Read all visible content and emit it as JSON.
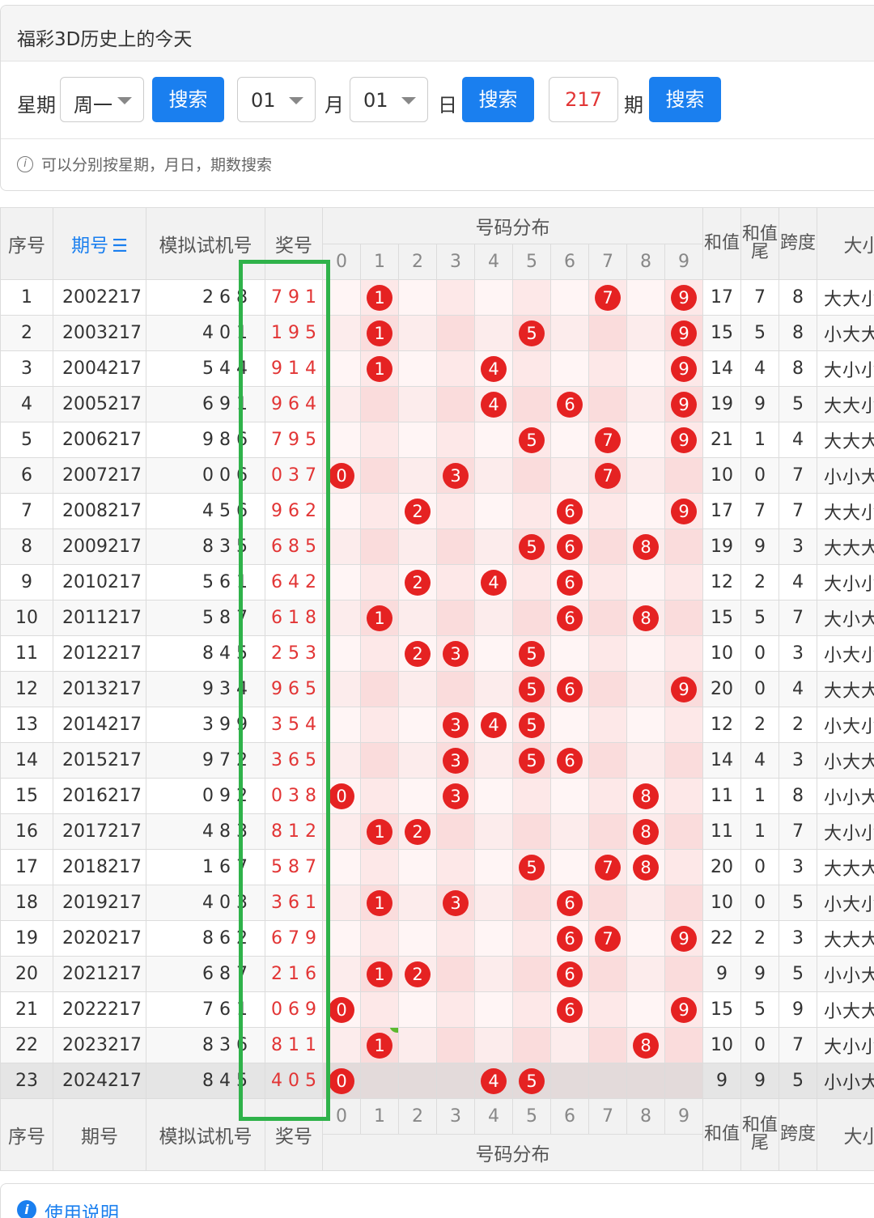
{
  "page": {
    "title": "福彩3D历史上的今天"
  },
  "search": {
    "weekday_label": "星期",
    "weekday_value": "周一",
    "search_label": "搜索",
    "month_value": "01",
    "month_label": "月",
    "day_value": "01",
    "day_label": "日",
    "issue_value": "217",
    "issue_label": "期"
  },
  "tip": "可以分别按星期，月日，期数搜索",
  "table": {
    "head": {
      "seq": "序号",
      "issue": "期号",
      "sim": "模拟试机号",
      "win": "奖号",
      "dist": "号码分布",
      "sum": "和值",
      "sumtail": "和值尾",
      "span": "跨度",
      "dx": "大小"
    },
    "digits": [
      "0",
      "1",
      "2",
      "3",
      "4",
      "5",
      "6",
      "7",
      "8",
      "9"
    ],
    "rows": [
      {
        "seq": "1",
        "issue": "2002217",
        "sim": "268",
        "win": "791",
        "sum": "17",
        "tail": "7",
        "span": "8",
        "dx": "大大小"
      },
      {
        "seq": "2",
        "issue": "2003217",
        "sim": "401",
        "win": "195",
        "sum": "15",
        "tail": "5",
        "span": "8",
        "dx": "小大大"
      },
      {
        "seq": "3",
        "issue": "2004217",
        "sim": "544",
        "win": "914",
        "sum": "14",
        "tail": "4",
        "span": "8",
        "dx": "大小小"
      },
      {
        "seq": "4",
        "issue": "2005217",
        "sim": "691",
        "win": "964",
        "sum": "19",
        "tail": "9",
        "span": "5",
        "dx": "大大小"
      },
      {
        "seq": "5",
        "issue": "2006217",
        "sim": "986",
        "win": "795",
        "sum": "21",
        "tail": "1",
        "span": "4",
        "dx": "大大大"
      },
      {
        "seq": "6",
        "issue": "2007217",
        "sim": "006",
        "win": "037",
        "sum": "10",
        "tail": "0",
        "span": "7",
        "dx": "小小大"
      },
      {
        "seq": "7",
        "issue": "2008217",
        "sim": "456",
        "win": "962",
        "sum": "17",
        "tail": "7",
        "span": "7",
        "dx": "大大小"
      },
      {
        "seq": "8",
        "issue": "2009217",
        "sim": "835",
        "win": "685",
        "sum": "19",
        "tail": "9",
        "span": "3",
        "dx": "大大大"
      },
      {
        "seq": "9",
        "issue": "2010217",
        "sim": "561",
        "win": "642",
        "sum": "12",
        "tail": "2",
        "span": "4",
        "dx": "大小小"
      },
      {
        "seq": "10",
        "issue": "2011217",
        "sim": "587",
        "win": "618",
        "sum": "15",
        "tail": "5",
        "span": "7",
        "dx": "大小大"
      },
      {
        "seq": "11",
        "issue": "2012217",
        "sim": "845",
        "win": "253",
        "sum": "10",
        "tail": "0",
        "span": "3",
        "dx": "小大小"
      },
      {
        "seq": "12",
        "issue": "2013217",
        "sim": "934",
        "win": "965",
        "sum": "20",
        "tail": "0",
        "span": "4",
        "dx": "大大大"
      },
      {
        "seq": "13",
        "issue": "2014217",
        "sim": "399",
        "win": "354",
        "sum": "12",
        "tail": "2",
        "span": "2",
        "dx": "小大小"
      },
      {
        "seq": "14",
        "issue": "2015217",
        "sim": "972",
        "win": "365",
        "sum": "14",
        "tail": "4",
        "span": "3",
        "dx": "小大大"
      },
      {
        "seq": "15",
        "issue": "2016217",
        "sim": "092",
        "win": "038",
        "sum": "11",
        "tail": "1",
        "span": "8",
        "dx": "小小大"
      },
      {
        "seq": "16",
        "issue": "2017217",
        "sim": "483",
        "win": "812",
        "sum": "11",
        "tail": "1",
        "span": "7",
        "dx": "大小小"
      },
      {
        "seq": "17",
        "issue": "2018217",
        "sim": "167",
        "win": "587",
        "sum": "20",
        "tail": "0",
        "span": "3",
        "dx": "大大大"
      },
      {
        "seq": "18",
        "issue": "2019217",
        "sim": "403",
        "win": "361",
        "sum": "10",
        "tail": "0",
        "span": "5",
        "dx": "小大小"
      },
      {
        "seq": "19",
        "issue": "2020217",
        "sim": "862",
        "win": "679",
        "sum": "22",
        "tail": "2",
        "span": "3",
        "dx": "大大大"
      },
      {
        "seq": "20",
        "issue": "2021217",
        "sim": "687",
        "win": "216",
        "sum": "9",
        "tail": "9",
        "span": "5",
        "dx": "小小大"
      },
      {
        "seq": "21",
        "issue": "2022217",
        "sim": "761",
        "win": "069",
        "sum": "15",
        "tail": "5",
        "span": "9",
        "dx": "小大大"
      },
      {
        "seq": "22",
        "issue": "2023217",
        "sim": "836",
        "win": "811",
        "sum": "10",
        "tail": "0",
        "span": "7",
        "dx": "大小小"
      },
      {
        "seq": "23",
        "issue": "2024217",
        "sim": "845",
        "win": "405",
        "sum": "9",
        "tail": "9",
        "span": "5",
        "dx": "小小大"
      }
    ]
  },
  "help": "使用说明",
  "colors": {
    "ball": "#e52222",
    "button": "#1a7fef",
    "highlight_box": "#2fb24a",
    "repeat_badge": "#5cb82e"
  }
}
